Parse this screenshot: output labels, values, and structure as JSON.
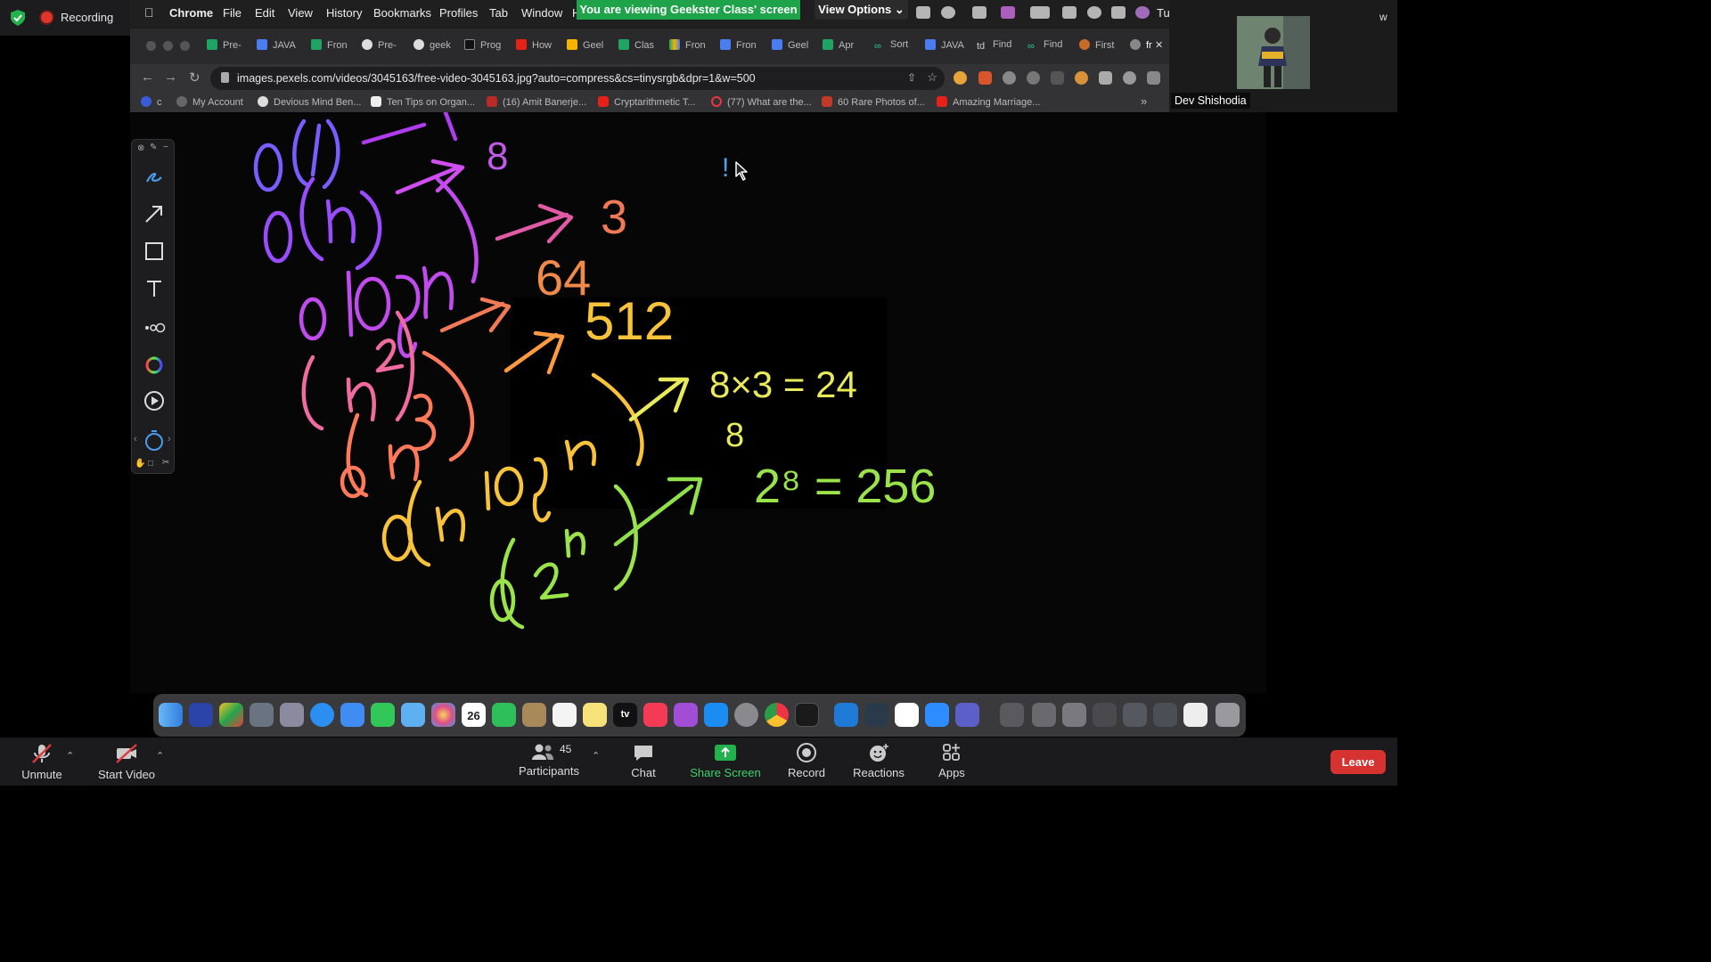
{
  "zoom": {
    "recording_label": "Recording",
    "viewing_banner": "You are viewing Geekster Class' screen",
    "view_options": "View Options",
    "participant_name": "Dev Shishodia",
    "bottom": {
      "unmute": "Unmute",
      "start_video": "Start Video",
      "participants": "Participants",
      "participant_count": "45",
      "chat": "Chat",
      "share_screen": "Share Screen",
      "record": "Record",
      "reactions": "Reactions",
      "apps": "Apps",
      "leave": "Leave"
    }
  },
  "menubar": {
    "app": "Chrome",
    "items": [
      "File",
      "Edit",
      "View",
      "History",
      "Bookmarks",
      "Profiles",
      "Tab",
      "Window",
      "H"
    ],
    "clock_fragment": "Tu",
    "right_fragment": "w"
  },
  "browser": {
    "tabs": [
      "Pre-",
      "JAVA",
      "Fron",
      "Pre-",
      "geek",
      "Prog",
      "How",
      "Geel",
      "Clas",
      "Fron",
      "Fron",
      "Geel",
      "Apr",
      "Sort",
      "JAVA",
      "Find",
      "Find",
      "First",
      "fr"
    ],
    "url": "images.pexels.com/videos/3045163/free-video-3045163.jpg?auto=compress&cs=tinysrgb&dpr=1&w=500",
    "bookmarks": [
      "c",
      "My Account",
      "Devious Mind Ben...",
      "Ten Tips on Organ...",
      "(16) Amit Banerje...",
      "Cryptarithmetic T...",
      "(77) What are the...",
      "60 Rare Photos of...",
      "Amazing Marriage..."
    ],
    "bookmarks_overflow": "»"
  },
  "whiteboard": {
    "lines": [
      {
        "expr": "O(1)",
        "result": "8",
        "color": "#7b5cff"
      },
      {
        "expr": "O(n)",
        "result": "",
        "color": "#a24dff"
      },
      {
        "expr": "O(log n)",
        "result": "3",
        "color": "#d94be0"
      },
      {
        "expr": "O(n²)",
        "result": "64",
        "color": "#f06ba0"
      },
      {
        "expr": "O(n³)",
        "result": "512",
        "color": "#ff8a50"
      },
      {
        "expr": "O(n log n)",
        "result": "8×3 = 24",
        "color": "#f2e34a"
      },
      {
        "expr": "O(2ⁿ)",
        "result": "2⁸ = 256",
        "color": "#9be34a"
      }
    ],
    "note_mark": "!",
    "exponent_mark": "8"
  },
  "dock": {
    "calendar_day": "26",
    "calendar_month": "APR",
    "tv_label": "tv"
  },
  "colors": {
    "banner_green": "#1fa34a",
    "leave_red": "#d63230",
    "share_green": "#23b14d"
  }
}
